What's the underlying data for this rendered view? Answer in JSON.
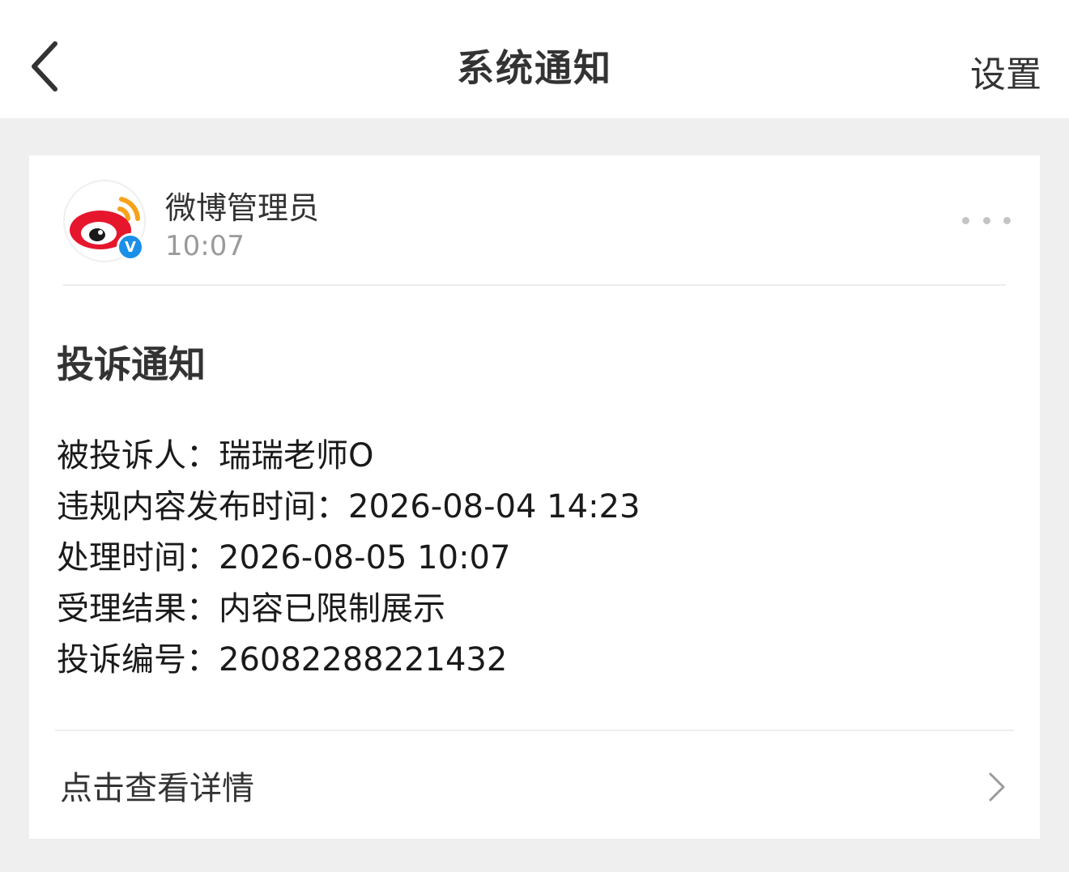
{
  "navbar": {
    "title": "系统通知",
    "right_label": "设置"
  },
  "message": {
    "sender_name": "微博管理员",
    "time": "10:07",
    "verified_badge": "V",
    "title": "投诉通知",
    "fields": [
      {
        "key": "被投诉人：",
        "value": "瑞瑞老师O"
      },
      {
        "key": "违规内容发布时间：",
        "value": "2026-08-04 14:23"
      },
      {
        "key": "处理时间：",
        "value": "2026-08-05 10:07"
      },
      {
        "key": "受理结果：",
        "value": "内容已限制展示"
      },
      {
        "key": "投诉编号：",
        "value": "26082288221432"
      }
    ],
    "detail_label": "点击查看详情"
  },
  "colors": {
    "accent_badge": "#1a8fe8",
    "weibo_red": "#e6162d",
    "weibo_orange": "#f7a21b"
  },
  "icons": [
    "back-chevron-icon",
    "weibo-logo-icon",
    "verified-icon",
    "more-dots-icon",
    "chevron-right-icon"
  ]
}
